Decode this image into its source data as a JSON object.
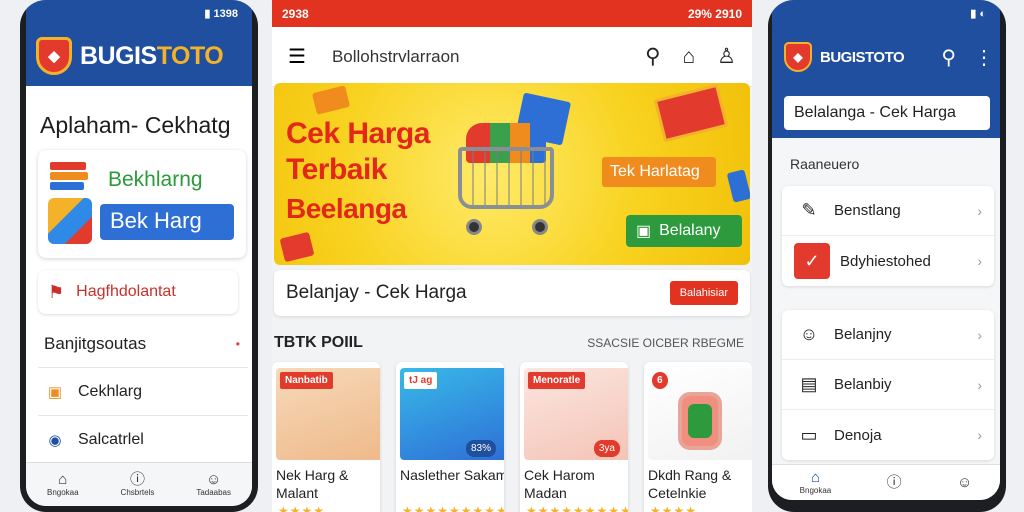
{
  "left_phone": {
    "brand": {
      "part1": "BUGIS",
      "part2": "TOTO"
    },
    "heading": "Aplaham- Cekhatg",
    "card": {
      "green_label": "Bekhlarng",
      "blue_button": "Bek Harg"
    },
    "red_row": "Hagfhdolantat",
    "list": [
      "Banjitgsoutas",
      "Cekhlarg",
      "Salcatrlel"
    ],
    "bottom_nav": [
      "Bngokaa",
      "Chsbrtels",
      "Tadaabas"
    ]
  },
  "middle": {
    "status_left": "2938",
    "status_right": "29% 2910",
    "title": "Bollohstrvlarraon",
    "banner": {
      "line1": "Cek Harga",
      "line2": "Terbaik",
      "line3": "Beelanga",
      "tag": "Tek Harlatag",
      "button": "Belalany"
    },
    "search_label": "Belanjay - Cek Harga",
    "search_button": "Balahisiar",
    "section_left": "TBTK POIIL",
    "section_right": "SSACSIE OICBER RBEGME",
    "products": [
      {
        "badge": "Nanbatib",
        "name": "Nek Harg & Malant",
        "stars": "★★★★",
        "pct": ""
      },
      {
        "badge": "tJ ag",
        "name": "Naslether Sakam",
        "stars": "★★★★★★★★★",
        "pct": "83%"
      },
      {
        "badge": "Menoratle",
        "name": "Cek Harom Madan",
        "stars": "★★★★★★★★★",
        "pct": "3ya"
      },
      {
        "badge": "6",
        "name": "Dkdh Rang & Cetelnkie",
        "stars": "★★★★",
        "pct": ""
      }
    ]
  },
  "right_phone": {
    "brand": "BUGISTOTO",
    "search_value": "Belalanga - Cek Harga",
    "section_label": "Raaneuero",
    "items_a": [
      "Benstlang",
      "Bdyhiestohed"
    ],
    "items_b": [
      "Belanjny",
      "Belanbiy",
      "Denoja"
    ],
    "bottom_nav": [
      "Bngokaa",
      "",
      ""
    ]
  },
  "colors": {
    "brand_blue": "#1f4f9e",
    "accent_red": "#e1331f",
    "accent_yellow": "#f3b229",
    "green": "#2e9a3e"
  }
}
